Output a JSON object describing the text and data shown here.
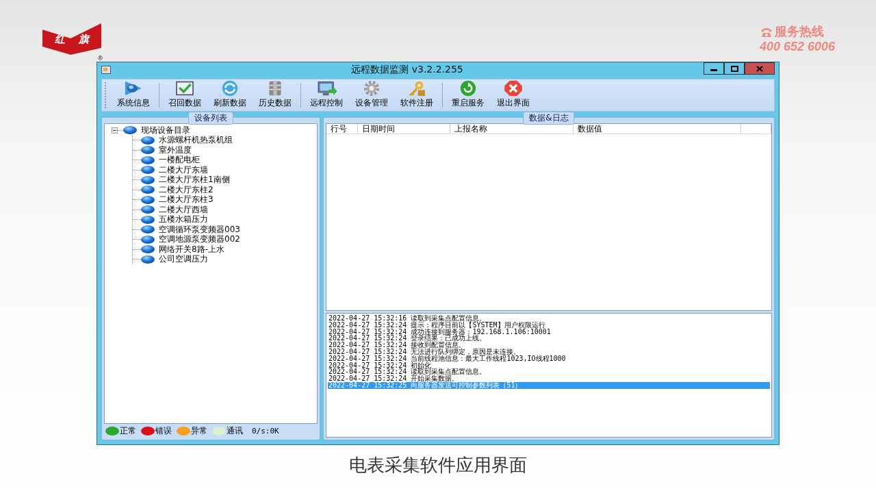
{
  "logo": {
    "chars": [
      "红",
      "旗"
    ],
    "mark": "®"
  },
  "hotline": {
    "label": "服务热线",
    "number": "400 652 6006"
  },
  "window": {
    "title": "远程数据监测 v3.2.2.255"
  },
  "toolbar": [
    {
      "label": "系统信息"
    },
    {
      "label": "召回数据"
    },
    {
      "label": "刷新数据"
    },
    {
      "label": "历史数据"
    },
    {
      "label": "远程控制"
    },
    {
      "label": "设备管理"
    },
    {
      "label": "软件注册"
    },
    {
      "label": "重启服务"
    },
    {
      "label": "退出界面"
    }
  ],
  "device_panel": {
    "title": "设备列表",
    "tree": [
      {
        "label": "现场设备目录",
        "expanded": true,
        "children": [
          {
            "label": "水源螺杆机热泵机组"
          },
          {
            "label": "室外温度"
          },
          {
            "label": "一楼配电柜"
          },
          {
            "label": "二楼大厅东墙"
          },
          {
            "label": "二楼大厅东柱1南侧"
          },
          {
            "label": "二楼大厅东柱2"
          },
          {
            "label": "二楼大厅东柱3"
          },
          {
            "label": "二楼大厅西墙"
          },
          {
            "label": "五楼水箱压力"
          },
          {
            "label": "空调循环泵变频器003"
          },
          {
            "label": "空调地源泵变频器002"
          },
          {
            "label": "网络开关8路-上水"
          },
          {
            "label": "公司空调压力"
          }
        ]
      }
    ],
    "legend": [
      {
        "label": "正常",
        "color": "#2aa82a"
      },
      {
        "label": "错误",
        "color": "#dd1111"
      },
      {
        "label": "异常",
        "color": "#f5a01e"
      },
      {
        "label": "通讯",
        "color": "#ddefd0"
      }
    ],
    "rate": "0/s:0K"
  },
  "data_panel": {
    "title": "数据&日志",
    "table": {
      "columns": [
        "行号",
        "日期时间",
        "上报名称",
        "数据值"
      ]
    },
    "log": [
      {
        "text": "2022-04-27 15:32:16 读取到采集点配置信息。",
        "selected": false
      },
      {
        "text": "2022-04-27 15:32:24 提示：程序目前以【SYSTEM】用户权限运行",
        "selected": false
      },
      {
        "text": "2022-04-27 15:32:24 成功连接到服务器：192.168.1.106:10001",
        "selected": false
      },
      {
        "text": "2022-04-27 15:32:24 登录结果：已成功上线。",
        "selected": false
      },
      {
        "text": "2022-04-27 15:32:24 接收到配置信息。",
        "selected": false
      },
      {
        "text": "2022-04-27 15:32:24 无法进行队列绑定，原因是未连接。",
        "selected": false
      },
      {
        "text": "2022-04-27 15:32:24 当前线程池信息：最大工作线程1023,IO线程1000",
        "selected": false
      },
      {
        "text": "2022-04-27 15:32:24 初始化",
        "selected": false
      },
      {
        "text": "2022-04-27 15:32:24 读取到采集点配置信息。",
        "selected": false
      },
      {
        "text": "2022-04-27 15:32:24 开始采集数据。",
        "selected": false
      },
      {
        "text": "2022-04-27 15:32:25 向服务器发送可控制参数列表（51）",
        "selected": true
      }
    ]
  },
  "caption": "电表采集软件应用界面"
}
